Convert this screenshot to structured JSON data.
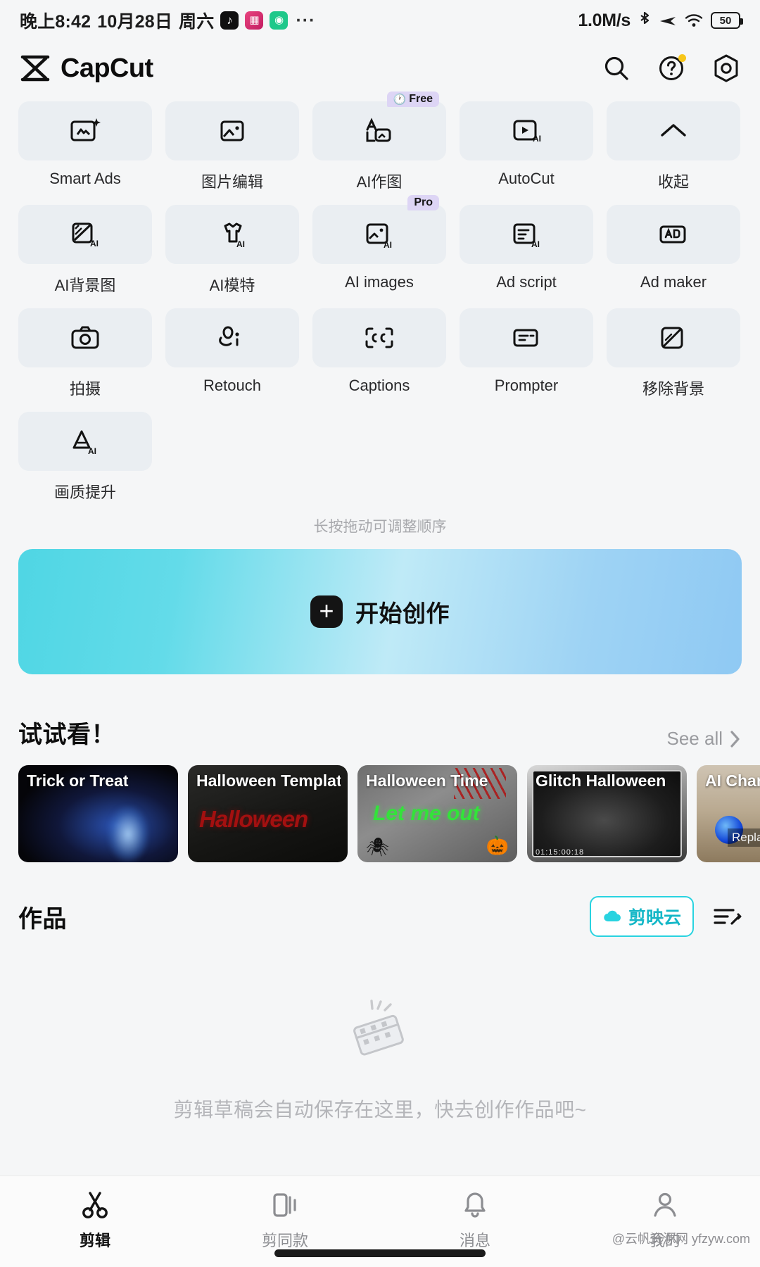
{
  "status_bar": {
    "time": "晚上8:42",
    "date": "10月28日",
    "weekday": "周六",
    "overflow": "···",
    "network_speed": "1.0M/s",
    "battery_level": "50",
    "app_icons": [
      "tiktok-icon",
      "pink-app-icon",
      "green-app-icon"
    ],
    "right_icons": [
      "bluetooth-icon",
      "airplane-mode-icon",
      "wifi-icon",
      "battery-icon"
    ]
  },
  "app_bar": {
    "brand_name": "CapCut",
    "logo_icon": "capcut-logo-icon",
    "actions": [
      {
        "name": "search-icon",
        "label": "search"
      },
      {
        "name": "help-icon",
        "label": "help",
        "has_dot": true
      },
      {
        "name": "settings-icon",
        "label": "settings"
      }
    ]
  },
  "tools": {
    "hint": "长按拖动可调整顺序",
    "rows": [
      [
        {
          "label": "Smart Ads",
          "icon": "smart-ads-icon",
          "badge": null
        },
        {
          "label": "图片编辑",
          "icon": "image-edit-icon",
          "badge": null
        },
        {
          "label": "AI作图",
          "icon": "ai-draw-icon",
          "badge": "Free"
        },
        {
          "label": "AutoCut",
          "icon": "autocut-icon",
          "badge": null
        },
        {
          "label": "收起",
          "icon": "chevron-up-icon",
          "badge": null
        }
      ],
      [
        {
          "label": "AI背景图",
          "icon": "ai-background-icon",
          "badge": null
        },
        {
          "label": "AI模特",
          "icon": "ai-model-icon",
          "badge": null
        },
        {
          "label": "AI images",
          "icon": "ai-images-icon",
          "badge": "Pro"
        },
        {
          "label": "Ad script",
          "icon": "ad-script-icon",
          "badge": null
        },
        {
          "label": "Ad maker",
          "icon": "ad-maker-icon",
          "badge": null
        }
      ],
      [
        {
          "label": "拍摄",
          "icon": "camera-icon",
          "badge": null
        },
        {
          "label": "Retouch",
          "icon": "retouch-icon",
          "badge": null
        },
        {
          "label": "Captions",
          "icon": "captions-icon",
          "badge": null
        },
        {
          "label": "Prompter",
          "icon": "prompter-icon",
          "badge": null
        },
        {
          "label": "移除背景",
          "icon": "remove-background-icon",
          "badge": null
        }
      ],
      [
        {
          "label": "画质提升",
          "icon": "enhance-quality-icon",
          "badge": null
        }
      ]
    ]
  },
  "cta": {
    "label": "开始创作",
    "icon": "plus-icon",
    "gradient_from": "#4fd6e4",
    "gradient_to": "#8fc9f3"
  },
  "try_section": {
    "title": "试试看！",
    "see_all": "See all",
    "chevron_icon": "chevron-right-icon",
    "cards": [
      {
        "title": "Trick or Treat"
      },
      {
        "title": "Halloween Templates",
        "overlay_text": "Halloween"
      },
      {
        "title": "Halloween Time",
        "overlay_text": "Let me out"
      },
      {
        "title": "Glitch Halloween",
        "timecode": "01:15:00:18"
      },
      {
        "title": "AI Characters",
        "tag": "Replaceable appearance"
      }
    ]
  },
  "works_section": {
    "title": "作品",
    "cloud_button": {
      "label": "剪映云",
      "icon": "cloud-icon",
      "accent": "#29d3e0"
    },
    "list_icon": "edit-list-icon",
    "empty_icon": "film-clapper-icon",
    "empty_text": "剪辑草稿会自动保存在这里，快去创作作品吧~"
  },
  "bottom_nav": {
    "items": [
      {
        "label": "剪辑",
        "icon": "scissors-icon",
        "active": true
      },
      {
        "label": "剪同款",
        "icon": "templates-icon",
        "active": false
      },
      {
        "label": "消息",
        "icon": "bell-icon",
        "active": false
      },
      {
        "label": "我的",
        "icon": "person-icon",
        "active": false
      }
    ]
  },
  "watermark": "@云帆资源网 yfzyw.com"
}
